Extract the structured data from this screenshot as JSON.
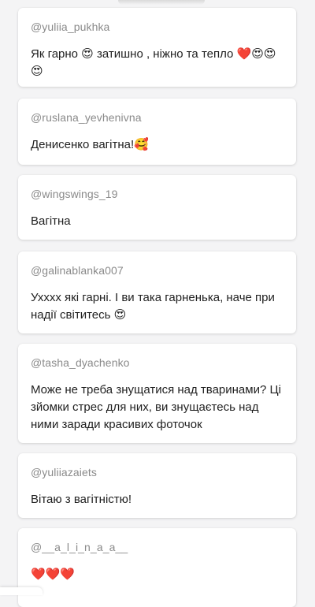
{
  "comments": [
    {
      "username": "@yuliia_pukhka",
      "text": "Як гарно 😍 затишно , ніжно та тепло ❤️😍😍😍"
    },
    {
      "username": "@ruslana_yevhenivna",
      "text": "Денисенко вагітна!🥰"
    },
    {
      "username": "@wingswings_19",
      "text": "Вагітна"
    },
    {
      "username": "@galinablanka007",
      "text": "Ухххх які гарні. І ви така гарненька, наче при надії світитесь 😍"
    },
    {
      "username": "@tasha_dyachenko",
      "text": "Може не треба знущатися над тваринами? Ці зйомки стрес для них, ви знущаєтесь над ними заради красивих фоточок"
    },
    {
      "username": "@yuliiazaiets",
      "text": "Вітаю з вагітністю!"
    },
    {
      "username": "@__a_l_i_n_a_a__",
      "text": "❤️❤️❤️"
    }
  ]
}
